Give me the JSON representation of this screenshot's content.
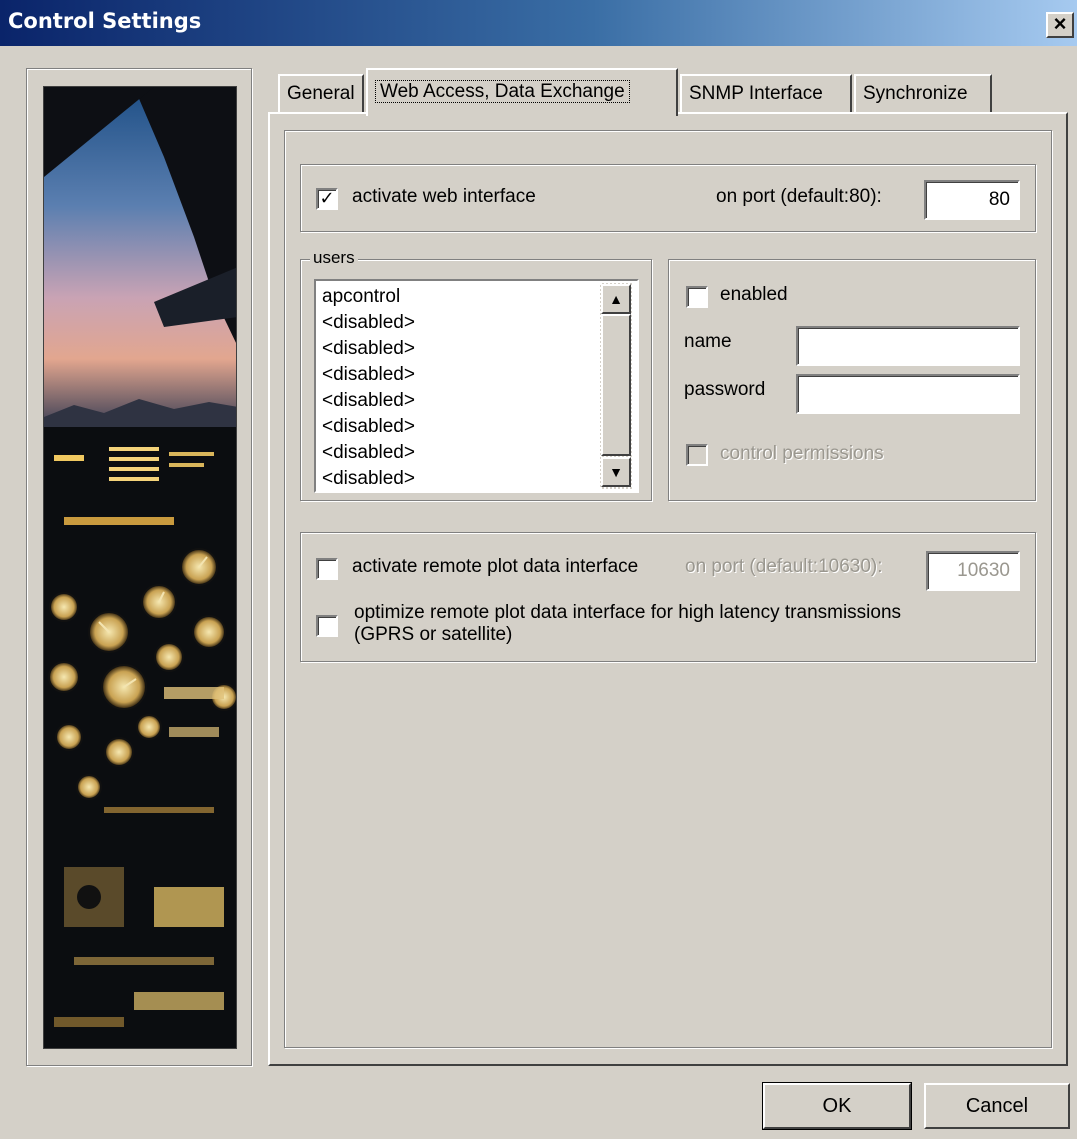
{
  "window": {
    "title": "Control Settings",
    "close_glyph": "×"
  },
  "tabs": [
    {
      "label": "General"
    },
    {
      "label": "Web Access, Data Exchange",
      "active": true
    },
    {
      "label": "SNMP Interface"
    },
    {
      "label": "Synchronize"
    }
  ],
  "web": {
    "activate_label": "activate web interface",
    "activate_checked": true,
    "port_label": "on port (default:80):",
    "port_value": "80"
  },
  "users": {
    "group_label": "users",
    "items": [
      "apcontrol",
      "<disabled>",
      "<disabled>",
      "<disabled>",
      "<disabled>",
      "<disabled>",
      "<disabled>",
      "<disabled>"
    ],
    "enabled_label": "enabled",
    "enabled_checked": false,
    "name_label": "name",
    "name_value": "",
    "password_label": "password",
    "password_value": "",
    "permissions_label": "control permissions",
    "permissions_checked": false
  },
  "remote": {
    "activate_label": "activate remote plot data interface",
    "activate_checked": false,
    "port_label": "on port (default:10630):",
    "port_value": "10630",
    "optimize_label_line1": "optimize remote plot data interface for high latency transmissions",
    "optimize_label_line2": "(GPRS or satellite)",
    "optimize_checked": false
  },
  "buttons": {
    "ok": "OK",
    "cancel": "Cancel"
  },
  "icons": {
    "close": "close-icon",
    "scroll_up": "scroll-up-arrow-icon",
    "scroll_down": "scroll-down-arrow-icon",
    "check": "checkmark-icon"
  },
  "colors": {
    "face": "#d4d0c8",
    "titlebar_start": "#0a246a",
    "titlebar_end": "#a6caf0"
  }
}
